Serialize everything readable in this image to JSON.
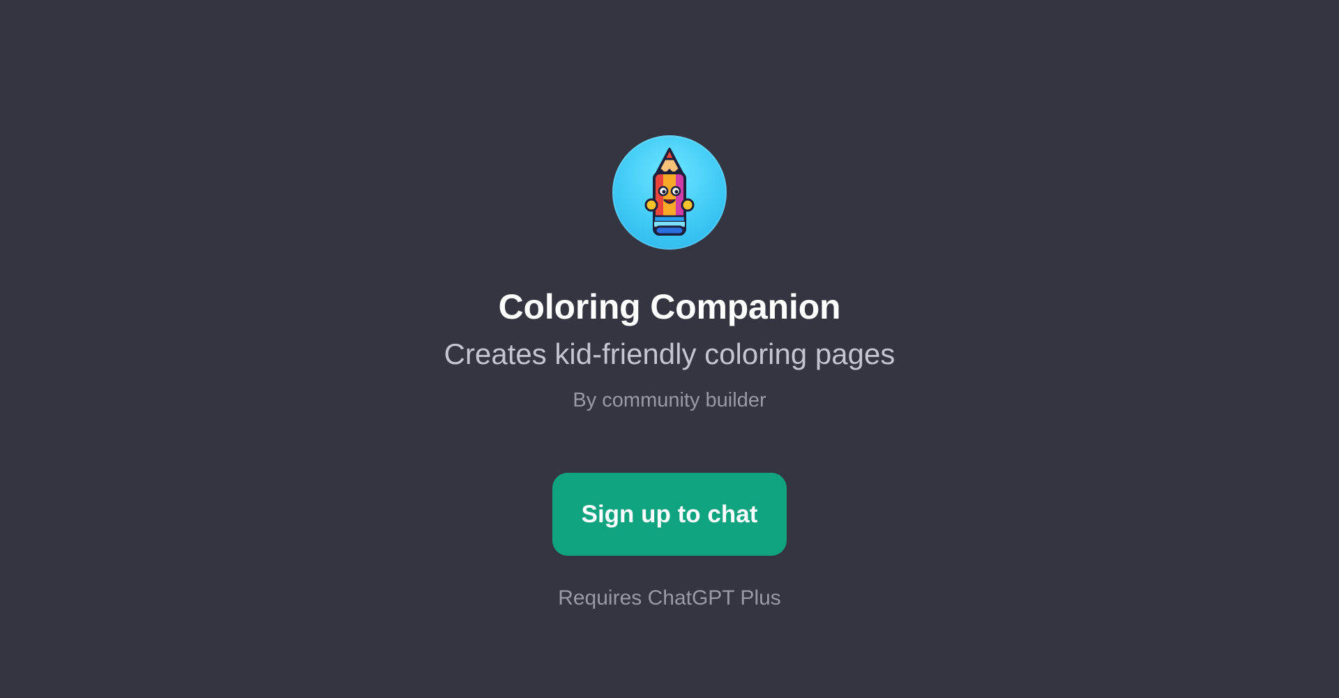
{
  "gpt": {
    "name": "Coloring Companion",
    "description": "Creates kid-friendly coloring pages",
    "author": "By community builder",
    "avatar_icon": "pencil-character-icon"
  },
  "actions": {
    "signup_label": "Sign up to chat",
    "requirement_note": "Requires ChatGPT Plus"
  },
  "colors": {
    "background": "#343541",
    "button": "#10a37f",
    "avatar_bg": "#3fcaf5"
  }
}
